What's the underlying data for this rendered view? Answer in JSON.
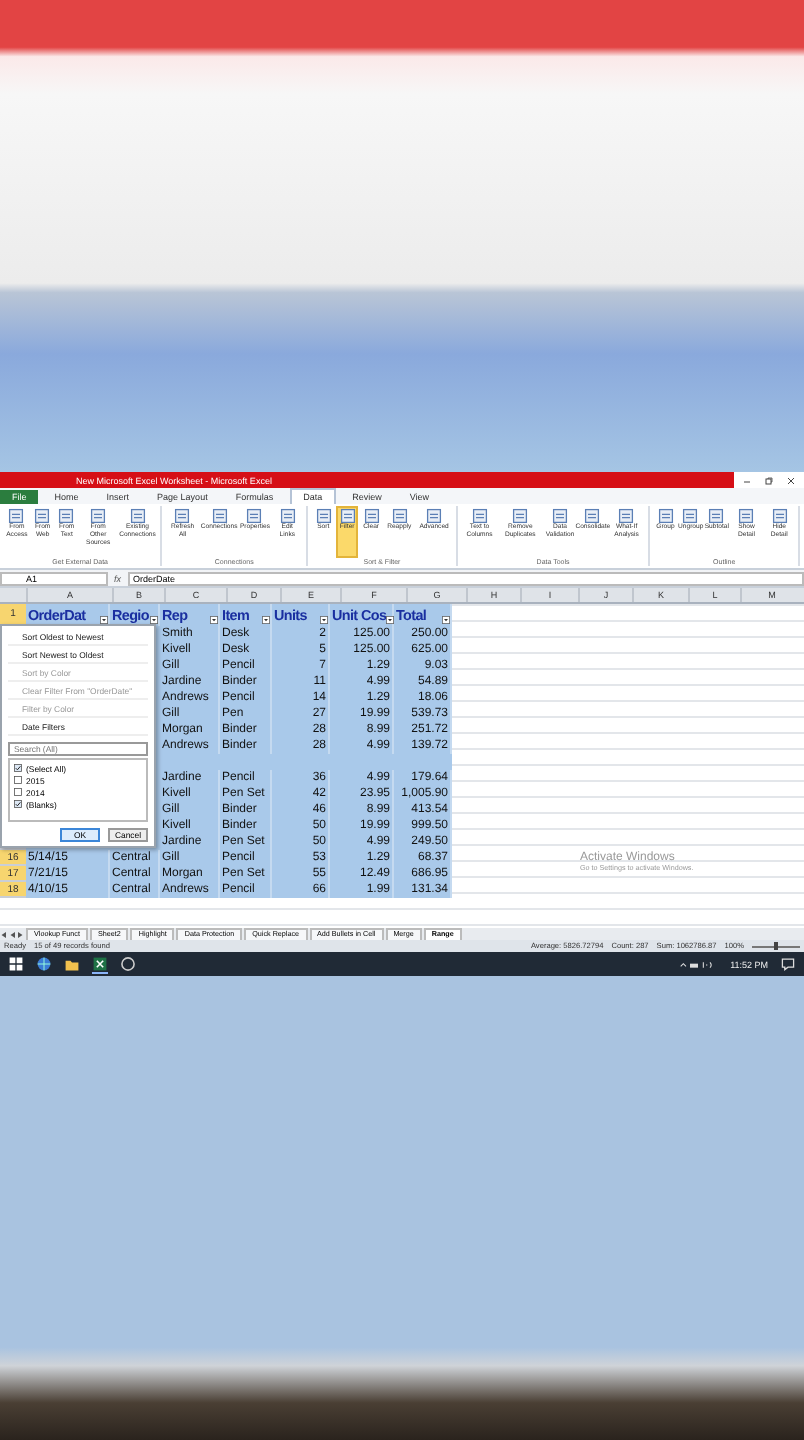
{
  "window": {
    "title": "New Microsoft Excel Worksheet - Microsoft Excel"
  },
  "ribbon": {
    "tabs": [
      {
        "label": "File",
        "selected": false
      },
      {
        "label": "Home",
        "selected": false
      },
      {
        "label": "Insert",
        "selected": false
      },
      {
        "label": "Page Layout",
        "selected": false
      },
      {
        "label": "Formulas",
        "selected": false
      },
      {
        "label": "Data",
        "selected": true
      },
      {
        "label": "Review",
        "selected": false
      },
      {
        "label": "View",
        "selected": false
      }
    ],
    "groups": [
      {
        "label": "Get External Data",
        "buttons": [
          {
            "label": "From Access",
            "selected": false
          },
          {
            "label": "From Web",
            "selected": false
          },
          {
            "label": "From Text",
            "selected": false
          },
          {
            "label": "From Other Sources",
            "selected": false
          },
          {
            "label": "Existing Connections",
            "selected": false
          }
        ]
      },
      {
        "label": "Connections",
        "buttons": [
          {
            "label": "Refresh All",
            "selected": false
          },
          {
            "label": "Connections",
            "selected": false
          },
          {
            "label": "Properties",
            "selected": false
          },
          {
            "label": "Edit Links",
            "selected": false
          }
        ]
      },
      {
        "label": "Sort & Filter",
        "buttons": [
          {
            "label": "Sort",
            "selected": false
          },
          {
            "label": "Filter",
            "selected": true
          },
          {
            "label": "Clear",
            "selected": false
          },
          {
            "label": "Reapply",
            "selected": false
          },
          {
            "label": "Advanced",
            "selected": false
          }
        ]
      },
      {
        "label": "Data Tools",
        "buttons": [
          {
            "label": "Text to Columns",
            "selected": false
          },
          {
            "label": "Remove Duplicates",
            "selected": false
          },
          {
            "label": "Data Validation",
            "selected": false
          },
          {
            "label": "Consolidate",
            "selected": false
          },
          {
            "label": "What-If Analysis",
            "selected": false
          }
        ]
      },
      {
        "label": "Outline",
        "buttons": [
          {
            "label": "Group",
            "selected": false
          },
          {
            "label": "Ungroup",
            "selected": false
          },
          {
            "label": "Subtotal",
            "selected": false
          },
          {
            "label": "Show Detail",
            "selected": false
          },
          {
            "label": "Hide Detail",
            "selected": false
          }
        ]
      }
    ]
  },
  "formula_bar": {
    "name_box": "A1",
    "fx_label": "fx",
    "formula": "OrderDate"
  },
  "columns": [
    "A",
    "B",
    "C",
    "D",
    "E",
    "F",
    "G",
    "H",
    "I",
    "J",
    "K",
    "L",
    "M"
  ],
  "sheet": {
    "header": {
      "number": "1",
      "cells": [
        "OrderDat",
        "Regio",
        "Rep",
        "Item",
        "Units",
        "Unit Cos",
        "Total"
      ]
    },
    "rows": [
      {
        "kind": "under_menu",
        "cells": [
          "Smith",
          "Desk",
          "2",
          "125.00",
          "250.00"
        ]
      },
      {
        "kind": "under_menu",
        "cells": [
          "Kivell",
          "Desk",
          "5",
          "125.00",
          "625.00"
        ]
      },
      {
        "kind": "under_menu",
        "cells": [
          "Gill",
          "Pencil",
          "7",
          "1.29",
          "9.03"
        ]
      },
      {
        "kind": "under_menu",
        "cells": [
          "Jardine",
          "Binder",
          "11",
          "4.99",
          "54.89"
        ]
      },
      {
        "kind": "under_menu",
        "cells": [
          "Andrews",
          "Pencil",
          "14",
          "1.29",
          "18.06"
        ]
      },
      {
        "kind": "under_menu",
        "cells": [
          "Gill",
          "Pen",
          "27",
          "19.99",
          "539.73"
        ]
      },
      {
        "kind": "under_menu",
        "cells": [
          "Morgan",
          "Binder",
          "28",
          "8.99",
          "251.72"
        ]
      },
      {
        "kind": "under_menu",
        "cells": [
          "Andrews",
          "Binder",
          "28",
          "4.99",
          "139.72"
        ]
      },
      {
        "kind": "blank"
      },
      {
        "kind": "under_menu",
        "cells": [
          "Jardine",
          "Pencil",
          "36",
          "4.99",
          "179.64"
        ]
      },
      {
        "kind": "under_menu",
        "cells": [
          "Kivell",
          "Pen Set",
          "42",
          "23.95",
          "1,005.90"
        ]
      },
      {
        "kind": "under_menu",
        "cells": [
          "Gill",
          "Binder",
          "46",
          "8.99",
          "413.54"
        ]
      },
      {
        "kind": "under_menu",
        "cells": [
          "Kivell",
          "Binder",
          "50",
          "19.99",
          "999.50"
        ]
      },
      {
        "kind": "under_menu",
        "cells": [
          "Jardine",
          "Pen Set",
          "50",
          "4.99",
          "249.50"
        ]
      },
      {
        "kind": "full",
        "number": "16",
        "cells": [
          "5/14/15",
          "Central",
          "Gill",
          "Pencil",
          "53",
          "1.29",
          "68.37"
        ]
      },
      {
        "kind": "full",
        "number": "17",
        "cells": [
          "7/21/15",
          "Central",
          "Morgan",
          "Pen Set",
          "55",
          "12.49",
          "686.95"
        ]
      },
      {
        "kind": "full",
        "number": "18",
        "cells": [
          "4/10/15",
          "Central",
          "Andrews",
          "Pencil",
          "66",
          "1.99",
          "131.34"
        ]
      }
    ]
  },
  "filter_menu": {
    "items": [
      {
        "label": "Sort Oldest to Newest",
        "disabled": false
      },
      {
        "label": "Sort Newest to Oldest",
        "disabled": false
      },
      {
        "label": "Sort by Color",
        "disabled": true
      },
      {
        "label": "Clear Filter From \"OrderDate\"",
        "disabled": true
      },
      {
        "label": "Filter by Color",
        "disabled": true
      },
      {
        "label": "Date Filters",
        "disabled": false
      }
    ],
    "search": {
      "placeholder": "Search (All)"
    },
    "tree": [
      {
        "label": "(Select All)",
        "checked": true
      },
      {
        "label": "2015",
        "checked": false
      },
      {
        "label": "2014",
        "checked": false
      },
      {
        "label": "(Blanks)",
        "checked": true
      }
    ],
    "buttons": [
      "OK",
      "Cancel"
    ]
  },
  "sheet_tabs": [
    {
      "label": "Vlookup Funct",
      "selected": false
    },
    {
      "label": "Sheet2",
      "selected": false
    },
    {
      "label": "Highlight",
      "selected": false
    },
    {
      "label": "Data Protection",
      "selected": false
    },
    {
      "label": "Quick Replace",
      "selected": false
    },
    {
      "label": "Add Bullets in Cell",
      "selected": false
    },
    {
      "label": "Merge",
      "selected": false
    },
    {
      "label": "Range",
      "selected": true
    }
  ],
  "watermark_notice": {
    "title": "Activate Windows",
    "text": "Go to Settings to activate Windows."
  },
  "status_bar": {
    "mode": "Ready",
    "message": "15 of 49 records found",
    "average": "Average: 5826.72794",
    "count": "Count: 287",
    "sum": "Sum: 1062786.87",
    "zoom": "100%",
    "zoom_slider": {
      "level": 0.5
    }
  },
  "taskbar": {
    "time": "11:52 PM"
  }
}
